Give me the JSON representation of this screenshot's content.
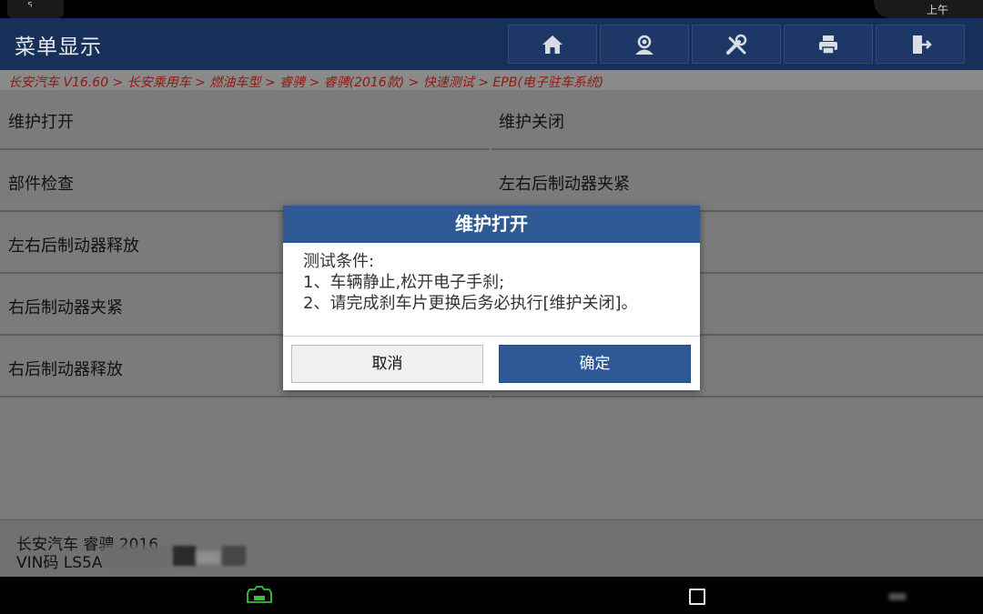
{
  "status_bar": {
    "clock": "上午"
  },
  "header": {
    "title": "菜单显示",
    "toolbar": [
      "home-icon",
      "user-icon",
      "tools-icon",
      "print-icon",
      "exit-icon"
    ]
  },
  "breadcrumb": "长安汽车 V16.60 > 长安乘用车 > 燃油车型 > 睿骋 > 睿骋(2016款) > 快速测试 > EPB(电子驻车系统)",
  "menu": {
    "left": [
      "维护打开",
      "部件检查",
      "左右后制动器释放",
      "右后制动器夹紧",
      "右后制动器释放"
    ],
    "right": [
      "维护关闭",
      "左右后制动器夹紧"
    ]
  },
  "dialog": {
    "title": "维护打开",
    "lines": [
      "测试条件:",
      "1、车辆静止,松开电子手刹;",
      "2、请完成刹车片更换后务必执行[维护关闭]。"
    ],
    "cancel_label": "取消",
    "ok_label": "确定"
  },
  "footer": {
    "vehicle": "长安汽车 睿骋 2016",
    "vin": "VIN码 LS5A"
  },
  "colors": {
    "header_bg": "#17305a",
    "dialog_title_bg": "#2e5a93",
    "ok_button_bg": "#2d5a96",
    "breadcrumb_text": "#8e1a12",
    "vci_icon": "#3ac23a"
  }
}
